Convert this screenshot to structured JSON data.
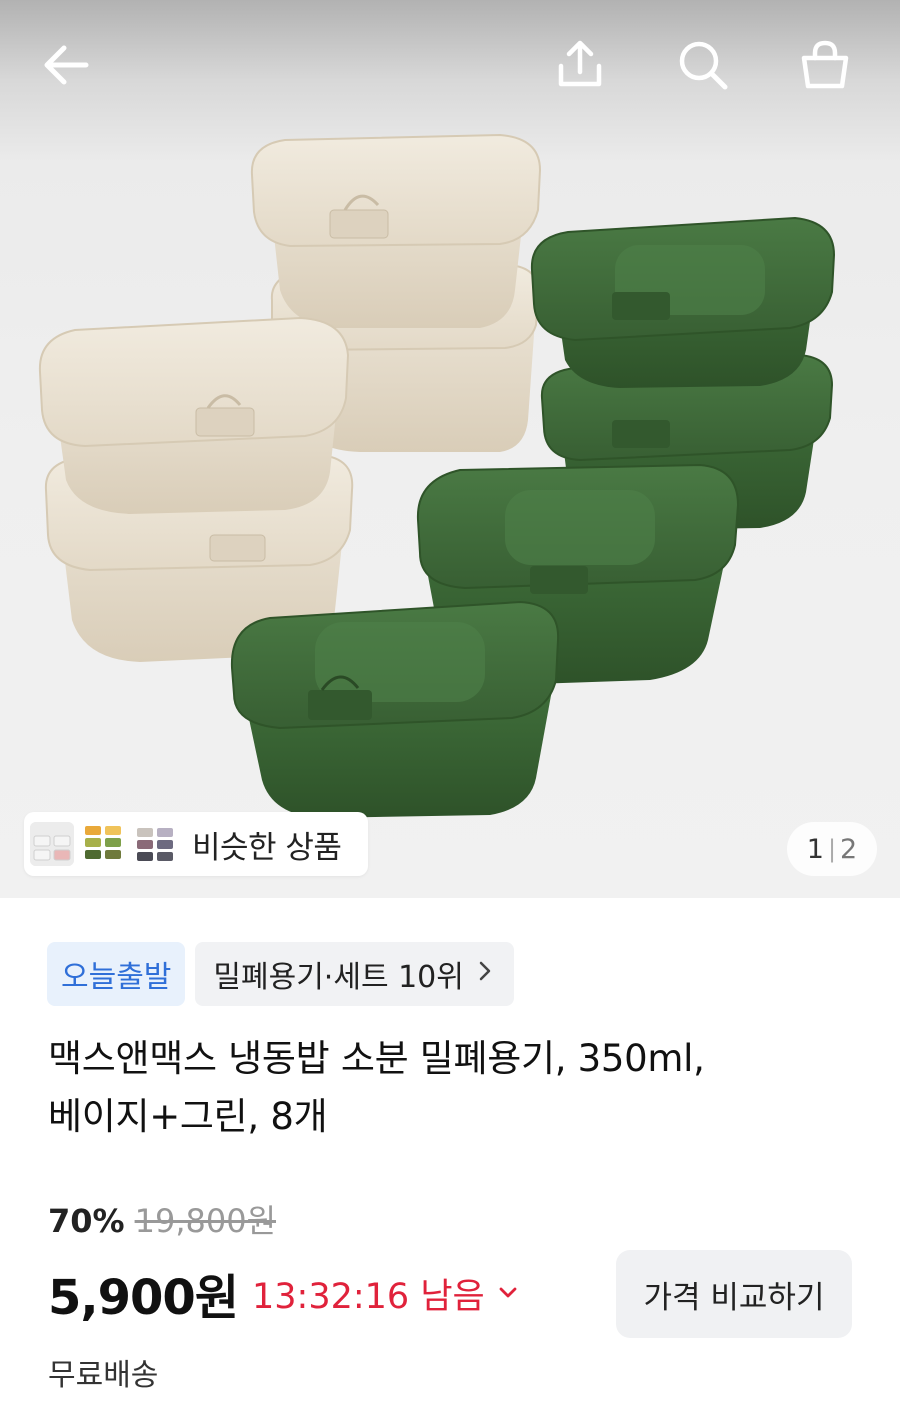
{
  "header": {
    "icons": {
      "back": "arrow-left-icon",
      "share": "share-icon",
      "search": "search-icon",
      "cart": "cart-icon"
    }
  },
  "gallery": {
    "similar_label": "비슷한 상품",
    "page_current": "1",
    "page_separator": "|",
    "page_total": "2",
    "colors": {
      "beige": "#e6dccb",
      "green": "#3c6b37"
    }
  },
  "product": {
    "badge_today": "오늘출발",
    "rank_label": "밀폐용기·세트 10위",
    "title_line1": "맥스앤맥스 냉동밥 소분 밀폐용기, 350ml,",
    "title_line2": "베이지+그린, 8개",
    "discount_percent": "70%",
    "original_price": "19,800원",
    "price": "5,900원",
    "timer": "13:32:16 남음",
    "compare_button": "가격 비교하기",
    "shipping": "무료배송",
    "colors": {
      "timer": "#e0223b",
      "badge_text": "#2f6fd8",
      "badge_bg": "#e8f1fc"
    }
  }
}
